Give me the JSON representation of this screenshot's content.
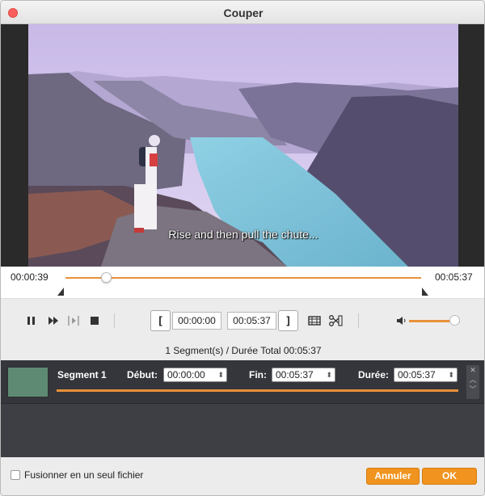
{
  "window": {
    "title": "Couper"
  },
  "video": {
    "subtitle": "Rise and then pull the chute..."
  },
  "timeline": {
    "current_time": "00:00:39",
    "total_time": "00:05:37",
    "playhead_fraction": 0.115
  },
  "controls": {
    "pause_icon": "pause-icon",
    "next_frame_icon": "fast-forward-icon",
    "step_icon": "step-frame-icon",
    "stop_icon": "stop-icon",
    "start_bracket": "[",
    "end_bracket": "]",
    "start_time": "00:00:00",
    "end_time": "00:05:37",
    "volume_fraction": 0.9
  },
  "summary": "1 Segment(s) / Durée Total 00:05:37",
  "segments": [
    {
      "name": "Segment 1",
      "start_label": "Début:",
      "start_value": "00:00:00",
      "end_label": "Fin:",
      "end_value": "00:05:37",
      "duration_label": "Durée:",
      "duration_value": "00:05:37"
    }
  ],
  "footer": {
    "merge_label": "Fusionner en un seul fichier",
    "merge_checked": false,
    "cancel_label": "Annuler",
    "ok_label": "OK"
  },
  "colors": {
    "accent": "#e8913a",
    "button": "#f0941f",
    "close": "#fc605c"
  }
}
